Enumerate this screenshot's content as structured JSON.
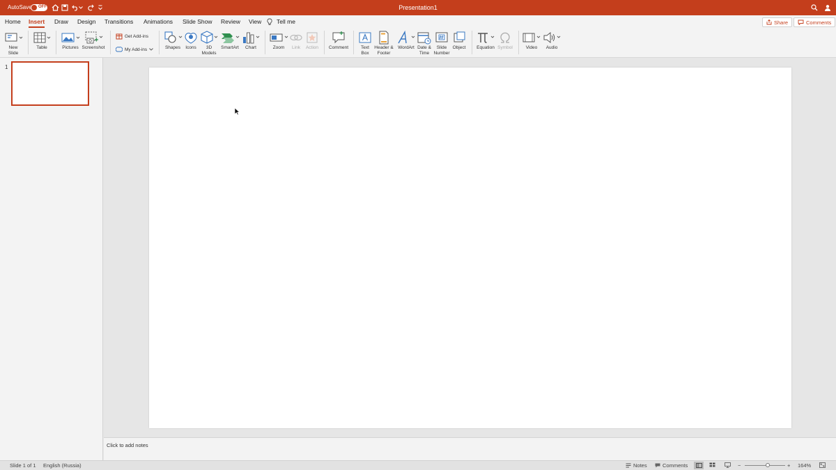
{
  "titlebar": {
    "autosave_label": "AutoSave",
    "autosave_state": "OFF",
    "document_title": "Presentation1"
  },
  "tabs": [
    {
      "label": "Home"
    },
    {
      "label": "Insert",
      "active": true
    },
    {
      "label": "Draw"
    },
    {
      "label": "Design"
    },
    {
      "label": "Transitions"
    },
    {
      "label": "Animations"
    },
    {
      "label": "Slide Show"
    },
    {
      "label": "Review"
    },
    {
      "label": "View"
    },
    {
      "label": "Tell me"
    }
  ],
  "top_buttons": {
    "share": "Share",
    "comments": "Comments"
  },
  "ribbon": {
    "new_slide": [
      "New",
      "Slide"
    ],
    "table": "Table",
    "pictures": "Pictures",
    "screenshot": "Screenshot",
    "get_addins": "Get Add-ins",
    "my_addins": "My Add-ins",
    "shapes": "Shapes",
    "icons": "Icons",
    "models3d": [
      "3D",
      "Models"
    ],
    "smartart": "SmartArt",
    "chart": "Chart",
    "zoom": "Zoom",
    "link": "Link",
    "action": "Action",
    "comment": "Comment",
    "text_box": [
      "Text",
      "Box"
    ],
    "header_footer": [
      "Header &",
      "Footer"
    ],
    "wordart": "WordArt",
    "date_time": [
      "Date &",
      "Time"
    ],
    "slide_number": [
      "Slide",
      "Number"
    ],
    "object": "Object",
    "equation": "Equation",
    "symbol": "Symbol",
    "video": "Video",
    "audio": "Audio"
  },
  "slides_panel": {
    "slide_number": "1"
  },
  "notes": {
    "placeholder": "Click to add notes"
  },
  "status": {
    "slide_count": "Slide 1 of 1",
    "language": "English (Russia)",
    "notes": "Notes",
    "comments": "Comments",
    "zoom_minus": "−",
    "zoom_plus": "+",
    "zoom_level": "164%"
  },
  "colors": {
    "accent": "#c43e1c",
    "ribbon_bg": "#f3f3f3",
    "canvas_bg": "#e6e6e6"
  }
}
